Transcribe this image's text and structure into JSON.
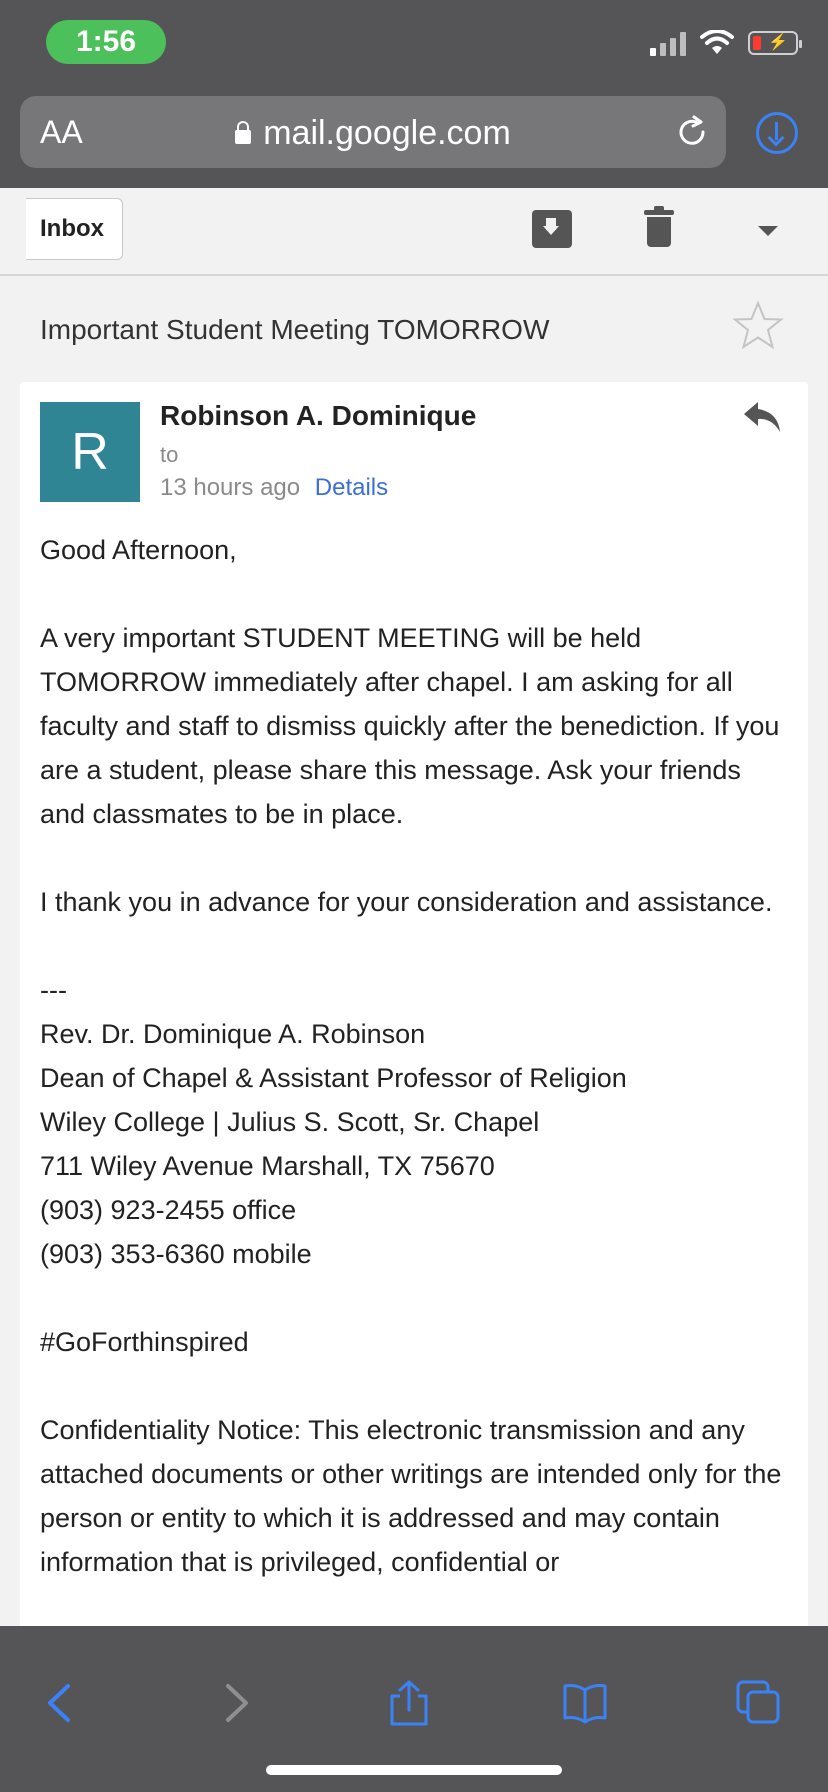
{
  "status_bar": {
    "time": "1:56"
  },
  "browser": {
    "text_size_label": "AA",
    "url": "mail.google.com"
  },
  "toolbar": {
    "back_label": "Inbox"
  },
  "email": {
    "subject": "Important Student Meeting TOMORROW",
    "avatar_letter": "R",
    "sender": "Robinson A. Dominique",
    "to_label": "to",
    "time_ago": "13 hours ago",
    "details_link": "Details",
    "greeting": "Good Afternoon,",
    "paragraph1": "A very important STUDENT MEETING will be held TOMORROW immediately after chapel. I am asking for all faculty and staff to dismiss quickly after the benediction. If you are a student, please share this message. Ask your friends and classmates to be in place.",
    "paragraph2": "I thank you in advance for your consideration and assistance.",
    "separator": "---",
    "signature": [
      "Rev. Dr. Dominique A. Robinson",
      "Dean of Chapel & Assistant Professor of Religion",
      "Wiley College | Julius S. Scott, Sr. Chapel",
      "711 Wiley Avenue Marshall, TX 75670",
      "(903) 923-2455 office",
      "(903) 353-6360 mobile"
    ],
    "hashtag": "#GoForthinspired",
    "confidentiality": "Confidentiality Notice: This electronic transmission and any attached documents or other writings are intended only for the person or entity to which it is addressed and may contain information that is privileged, confidential or"
  },
  "colors": {
    "chrome": "#555557",
    "accent": "#3b82f6",
    "avatar": "#2f8593",
    "link": "#3b6fd8"
  }
}
